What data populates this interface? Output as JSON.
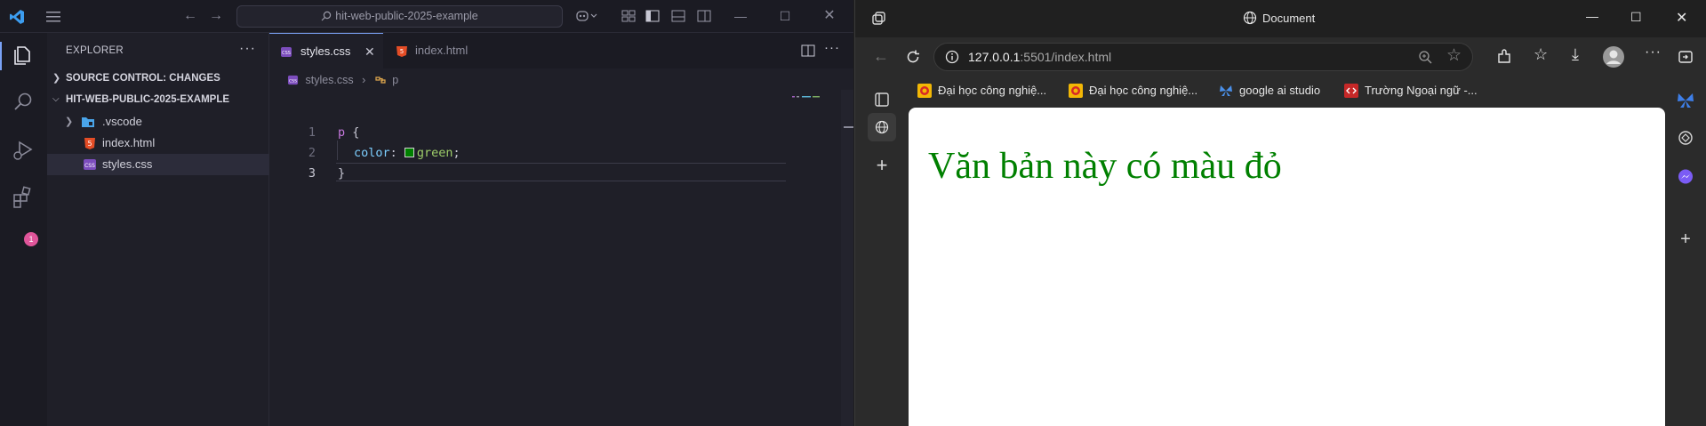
{
  "vscode": {
    "search_text": "hit-web-public-2025-example",
    "explorer_title": "EXPLORER",
    "source_control_section": "SOURCE CONTROL: CHANGES",
    "project_section": "HIT-WEB-PUBLIC-2025-EXAMPLE",
    "tree": [
      {
        "label": ".vscode",
        "type": "folder"
      },
      {
        "label": "index.html",
        "type": "html"
      },
      {
        "label": "styles.css",
        "type": "css"
      }
    ],
    "extensions_badge": "1",
    "tabs": [
      {
        "label": "styles.css",
        "active": true
      },
      {
        "label": "index.html",
        "active": false
      }
    ],
    "breadcrumb": {
      "file": "styles.css",
      "symbol": "p"
    },
    "line_numbers": [
      "1",
      "2",
      "3"
    ],
    "code": {
      "selector": "p",
      "open_brace": " {",
      "property": "color",
      "colon": ": ",
      "value": "green",
      "semicolon": ";",
      "close_brace": "}"
    },
    "minimap_text": "p {\n  color: green;\n}"
  },
  "browser": {
    "tab_title": "Document",
    "url_host": "127.0.0.1",
    "url_rest": ":5501/index.html",
    "favorites": [
      {
        "label": "Đại học công nghiệ...",
        "icon": "haui-logo-icon"
      },
      {
        "label": "Đại học công nghiệ...",
        "icon": "haui-logo-icon"
      },
      {
        "label": "google ai studio",
        "icon": "butterfly-icon"
      },
      {
        "label": "Trường Ngoại ngữ -...",
        "icon": "code-icon"
      }
    ],
    "page_heading": "Văn bản này có màu đỏ",
    "heading_color": "#008000"
  },
  "colors": {
    "vscode_bg": "#1f1f28",
    "accent": "#7aa2f7",
    "badge": "#e0559a"
  }
}
